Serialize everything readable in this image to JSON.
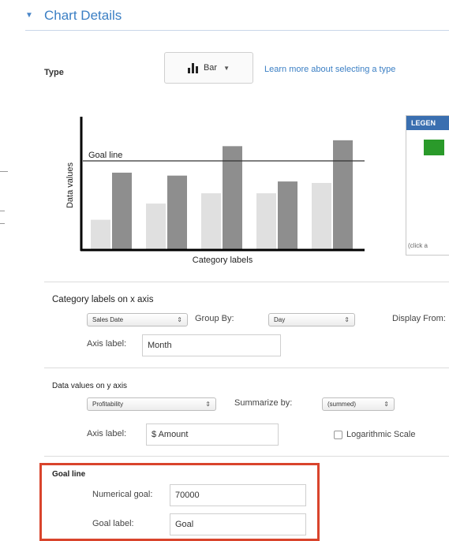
{
  "section": {
    "title": "Chart Details"
  },
  "type_row": {
    "label": "Type",
    "selected": "Bar",
    "learn_more": "Learn more about selecting a type"
  },
  "preview": {
    "goal_line_label": "Goal line",
    "y_axis_label": "Data values",
    "x_axis_label": "Category labels"
  },
  "legend": {
    "title": "LEGEN",
    "note": "(click a"
  },
  "x_axis": {
    "title": "Category labels on x axis",
    "field": "Sales Date",
    "group_by_label": "Group By:",
    "group_by": "Day",
    "display_from_label": "Display From:",
    "axis_label_label": "Axis label:",
    "axis_label_value": "Month"
  },
  "y_axis": {
    "title": "Data values on y axis",
    "field": "Profitability",
    "summarize_label": "Summarize by:",
    "summarize": "(summed)",
    "axis_label_label": "Axis label:",
    "axis_label_value": "$ Amount",
    "log_scale_label": "Logarithmic Scale"
  },
  "goal": {
    "title": "Goal line",
    "numerical_label": "Numerical goal:",
    "numerical_value": "70000",
    "goal_label_label": "Goal label:",
    "goal_label_value": "Goal"
  },
  "chart_data": {
    "type": "bar",
    "categories": [
      "",
      "",
      "",
      "",
      ""
    ],
    "series": [
      {
        "values": [
          20,
          31,
          38,
          38,
          45
        ]
      },
      {
        "values": [
          52,
          50,
          70,
          46,
          74
        ]
      }
    ],
    "goal": 60,
    "ylim": [
      0,
      90
    ],
    "xlabel": "Category labels",
    "ylabel": "Data values",
    "grid": false
  },
  "colors": {
    "accent": "#3b7fc4",
    "bar_light": "#e0e0e0",
    "bar_dark": "#8e8e8e",
    "highlight_border": "#d9442c",
    "legend_header": "#3a6fb0",
    "legend_swatch": "#2a9a2a"
  }
}
